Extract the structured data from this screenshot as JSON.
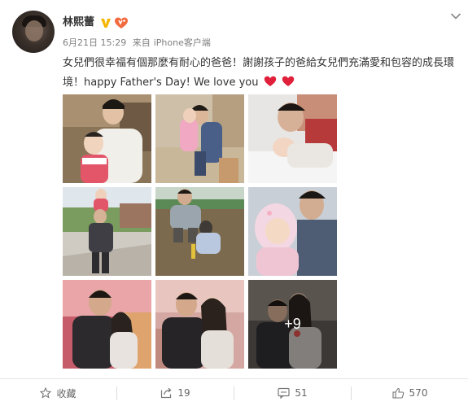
{
  "post": {
    "author": "林熙蕾",
    "date": "6月21日 15:29",
    "source_prefix": "来自",
    "source": "iPhone客户端",
    "text": "女兒們很幸福有個那麼有耐心的爸爸！謝謝孩子的爸給女兒們充滿愛和包容的成長環境！happy Father's Day! We love you",
    "more_photos": "+9"
  },
  "actions": {
    "favorite_label": "收藏",
    "repost_count": "19",
    "comment_count": "51",
    "like_count": "570"
  },
  "icons": [
    "chevron-down-icon",
    "verified-v-icon",
    "member-badge-icon",
    "heart-icon",
    "star-icon",
    "repost-icon",
    "comment-icon",
    "thumbs-up-icon"
  ],
  "colors": {
    "verified": "#f7b500",
    "heart": "#e0203a",
    "meta": "#808080",
    "text": "#333333"
  }
}
